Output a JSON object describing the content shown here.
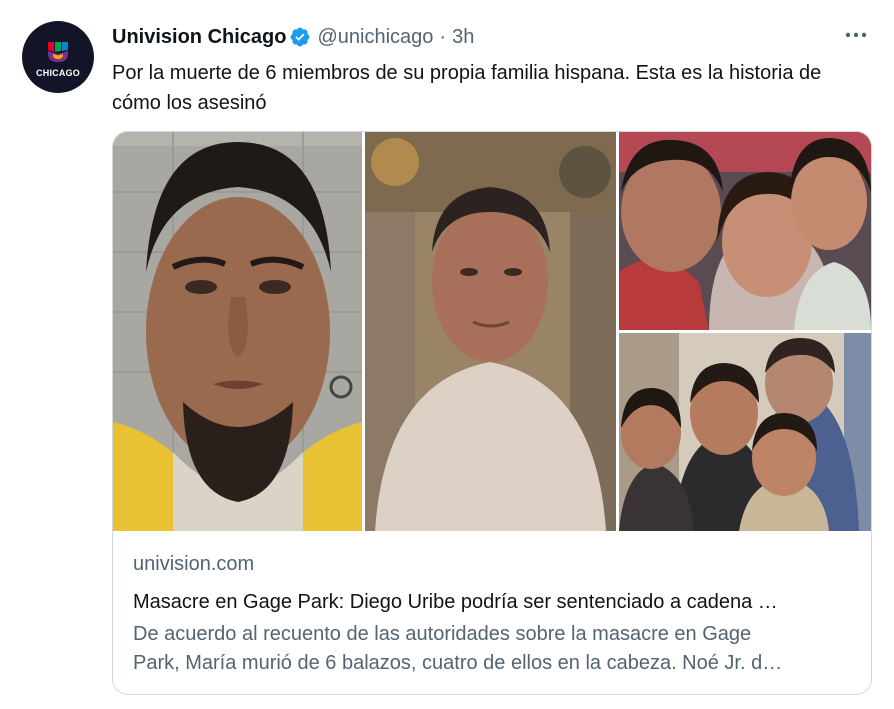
{
  "account": {
    "display_name": "Univision Chicago",
    "handle": "@unichicago",
    "separator": "·",
    "time": "3h",
    "avatar_text": "CHICAGO",
    "verified_icon": "verified-badge-icon"
  },
  "tweet": {
    "text": "Por la muerte de 6 miembros de su propia familia hispana. Esta es la historia de cómo los asesinó"
  },
  "card": {
    "domain": "univision.com",
    "title": "Masacre en Gage Park: Diego Uribe podría ser sentenciado a cadena …",
    "description_line1": "De acuerdo al recuento de las autoridades sobre la masacre en Gage",
    "description_line2": "Park, María murió de 6 balazos, cuatro de ellos en la cabeza. Noé Jr. d…"
  },
  "colors": {
    "primary_text": "#0f1419",
    "secondary_text": "#536471",
    "border": "#cfd9de",
    "verified_blue": "#1d9bf0"
  }
}
